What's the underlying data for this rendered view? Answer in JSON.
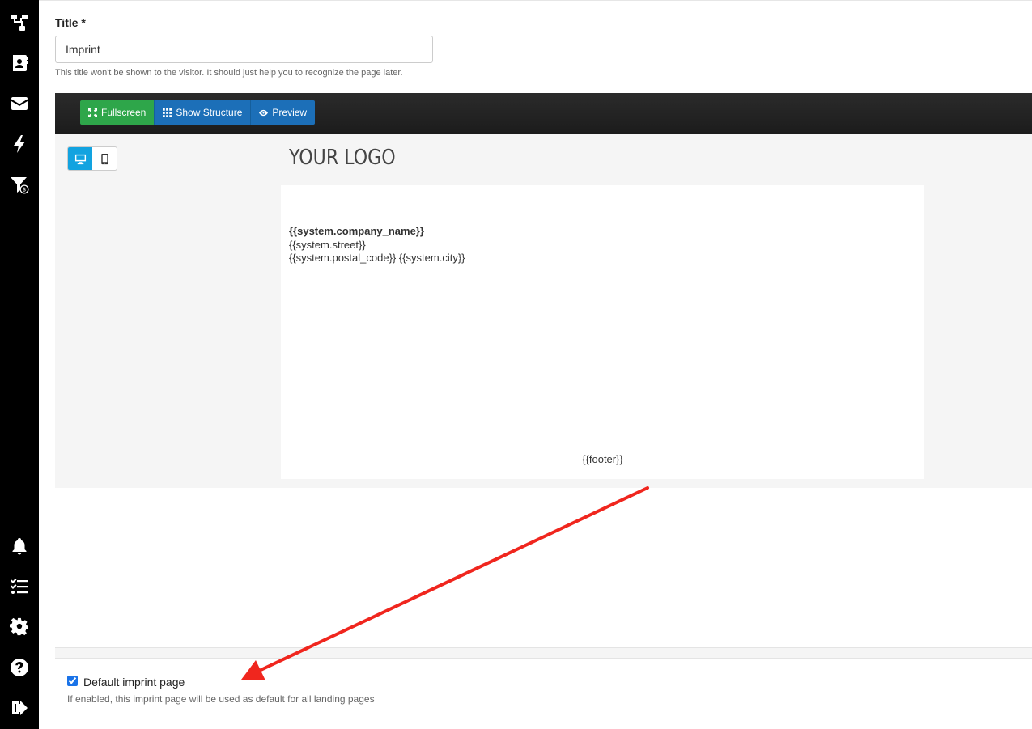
{
  "sidebar": {
    "items": [
      {
        "icon": "sitemap-icon"
      },
      {
        "icon": "contacts-book-icon"
      },
      {
        "icon": "envelope-icon"
      },
      {
        "icon": "bolt-icon"
      },
      {
        "icon": "funnel-dollar-icon"
      },
      {
        "icon": "bell-icon"
      },
      {
        "icon": "task-list-icon"
      },
      {
        "icon": "gear-icon"
      },
      {
        "icon": "help-circle-icon"
      },
      {
        "icon": "logout-icon"
      }
    ]
  },
  "form": {
    "title_label": "Title *",
    "title_value": "Imprint",
    "title_help": "This title won't be shown to the visitor. It should just help you to recognize the page later."
  },
  "toolbar": {
    "fullscreen_label": "Fullscreen",
    "structure_label": "Show Structure",
    "preview_label": "Preview"
  },
  "canvas": {
    "logo_text": "YOUR LOGO",
    "company_name": "{{system.company_name}}",
    "street": "{{system.street}}",
    "postal_city": "{{system.postal_code}} {{system.city}}",
    "footer": "{{footer}}"
  },
  "settings": {
    "default_imprint_label": "Default imprint page",
    "default_imprint_checked": true,
    "default_imprint_help": "If enabled, this imprint page will be used as default for all landing pages"
  },
  "colors": {
    "sidebar_bg": "#000000",
    "fullscreen_btn": "#2ea64a",
    "toolbar_btn": "#1c6fb8",
    "device_active": "#12a3e0",
    "annotation_arrow": "#f0261e"
  }
}
